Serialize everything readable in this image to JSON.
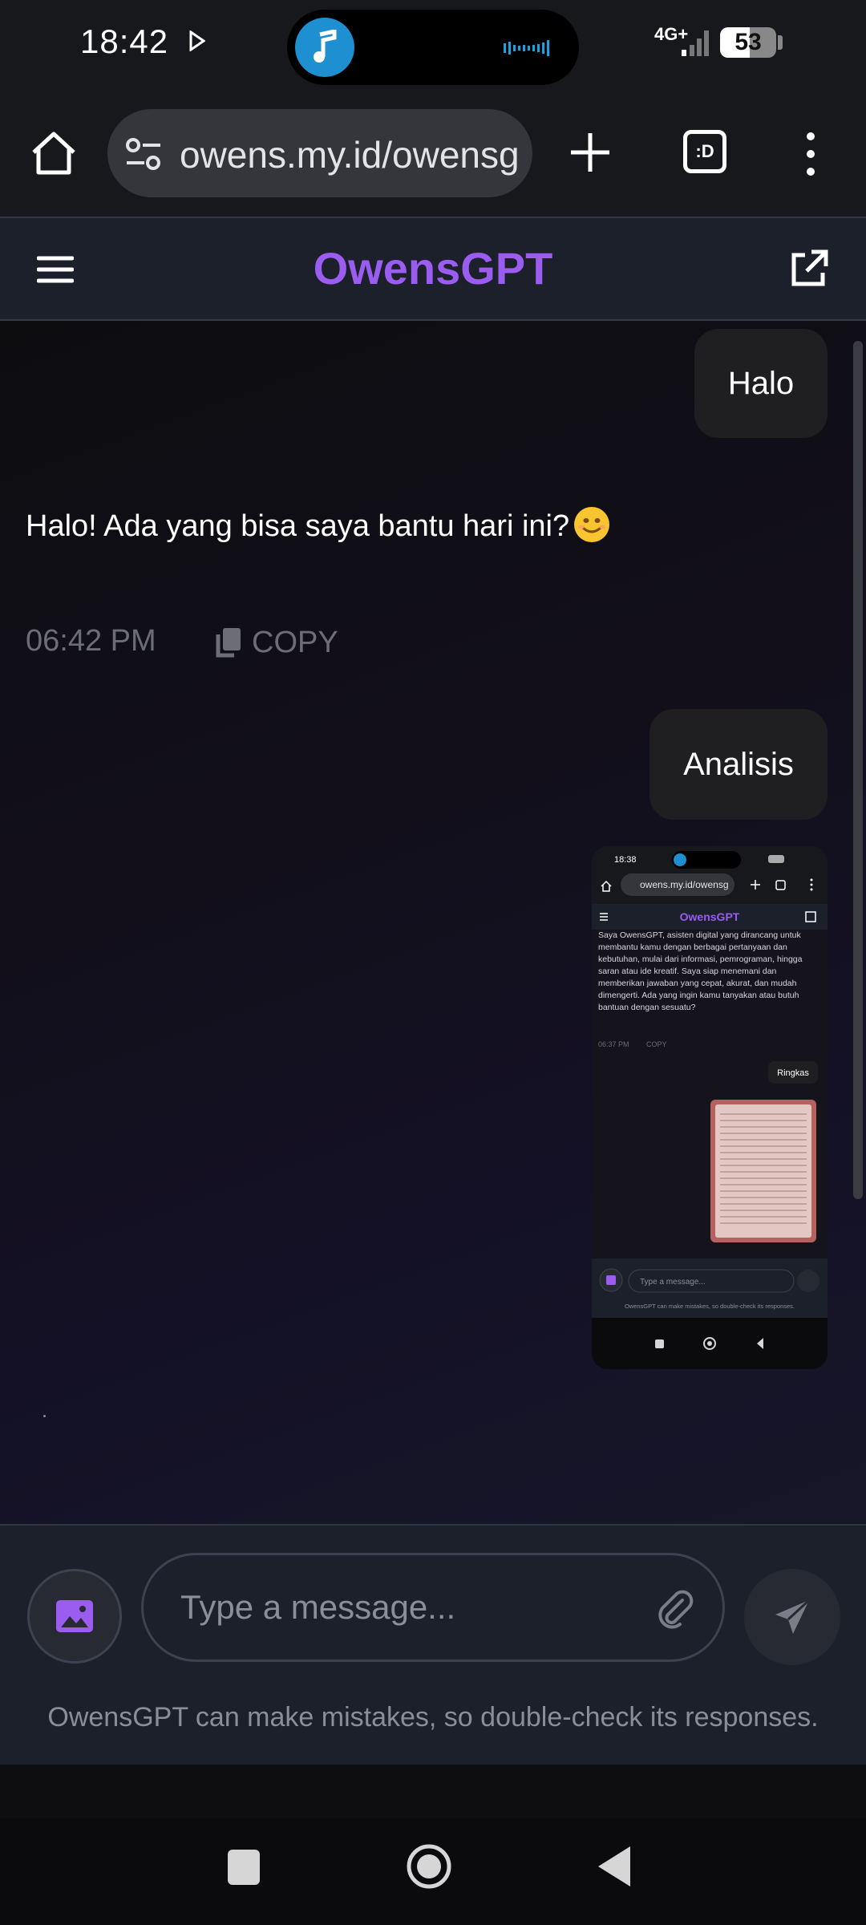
{
  "status_bar": {
    "time": "18:42",
    "network": "4G+",
    "battery": "53",
    "battery_level": 0.53
  },
  "browser": {
    "url": "owens.my.id/owensg",
    "tabs_label": ":D"
  },
  "header": {
    "title": "OwensGPT"
  },
  "chat": {
    "messages": [
      {
        "role": "user",
        "text": "Halo"
      },
      {
        "role": "assistant",
        "text": "Halo! Ada yang bisa saya bantu hari ini?",
        "time": "06:42 PM",
        "copy_label": "COPY"
      },
      {
        "role": "user",
        "text": "Analisis"
      }
    ],
    "attached_screenshot": {
      "status_time": "18:38",
      "url": "owens.my.id/owensg",
      "title": "OwensGPT",
      "text": "Saya OwensGPT, asisten digital yang dirancang untuk membantu kamu dengan berbagai pertanyaan dan kebutuhan, mulai dari informasi, pemrograman, hingga saran atau ide kreatif. Saya siap menemani dan memberikan jawaban yang cepat, akurat, dan mudah dimengerti. Ada yang ingin kamu tanyakan atau butuh bantuan dengan sesuatu?",
      "time": "06:37 PM",
      "copy_label": "COPY",
      "user_msg": "Ringkas",
      "placeholder": "Type a message...",
      "disclaimer": "OwensGPT can make mistakes, so double-check its responses."
    }
  },
  "input": {
    "placeholder": "Type a message...",
    "disclaimer": "OwensGPT can make mistakes, so double-check its responses."
  },
  "colors": {
    "accent": "#9b5cf0",
    "header_bg": "#1c202b",
    "bubble_bg": "#1f1f22"
  }
}
